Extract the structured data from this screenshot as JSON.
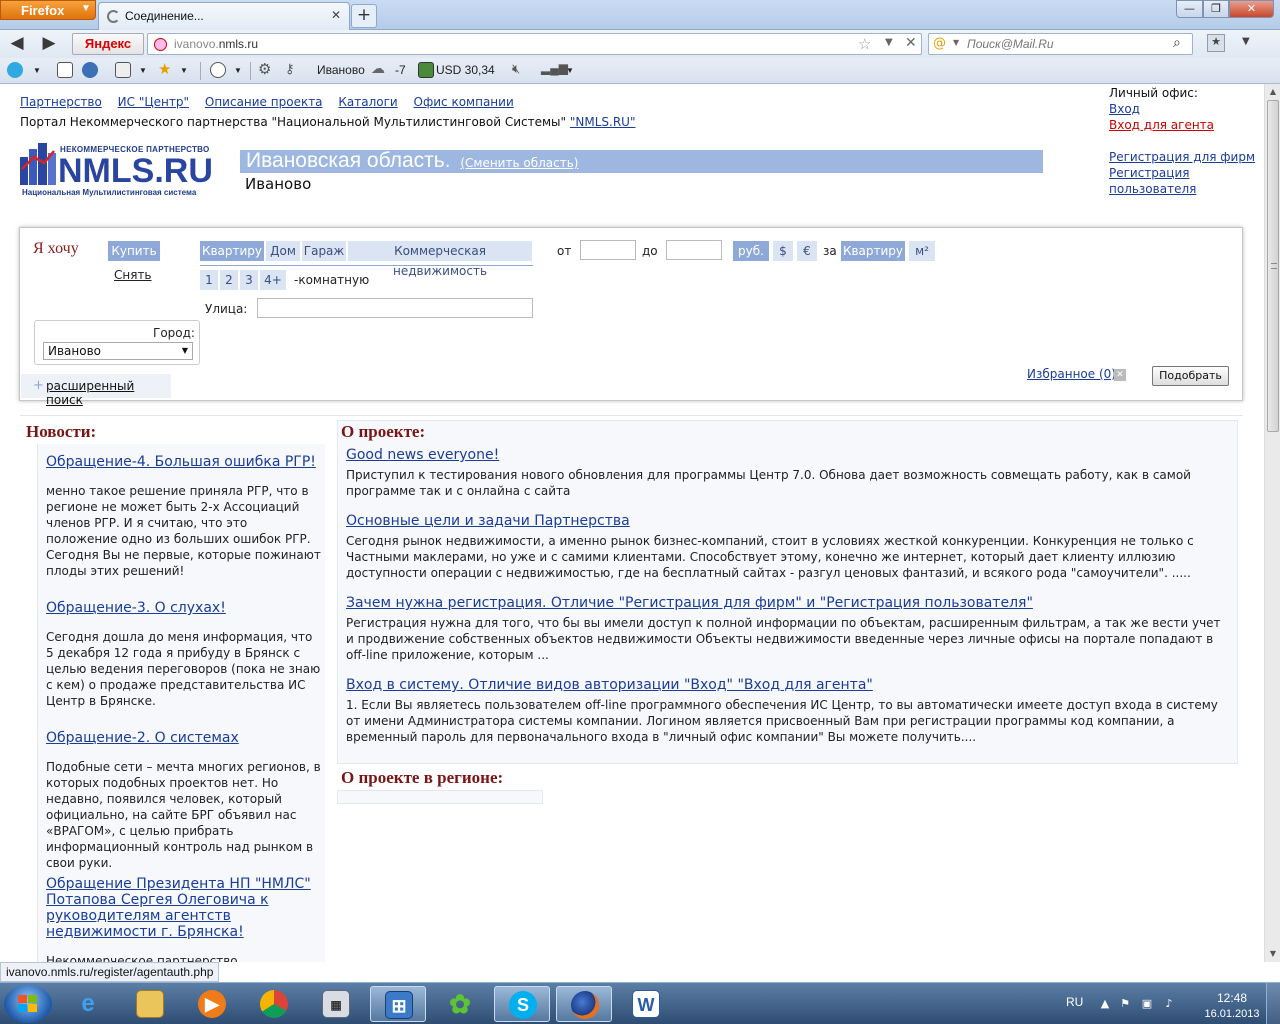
{
  "browser": {
    "app_button": "Firefox",
    "tab_title": "Соединение...",
    "yandex_button": "Яндекс",
    "url_host": "ivanovo.",
    "url_domain": "nmls.ru",
    "search_placeholder": "Поиск@Mail.Ru",
    "toolbar": {
      "city": "Иваново",
      "temperature": "-7",
      "currency": "USD 30,34"
    },
    "status_url": "ivanovo.nmls.ru/register/agentauth.php"
  },
  "header": {
    "links": [
      "Партнерство",
      "ИС \"Центр\"",
      "Описание проекта",
      "Каталоги",
      "Офис компании"
    ],
    "portal_text": "Портал Некоммерческого партнерства \"Национальной Мультилистинговой Системы\"",
    "portal_link": "\"NMLS.RU\"",
    "office_label": "Личный офис:",
    "login": "Вход",
    "agent_login": "Вход для агента",
    "register_firms": "Регистрация для фирм",
    "register_user": "Регистрация пользователя",
    "logo_top": "НЕКОММЕРЧЕСКОЕ ПАРТНЕРСТВО",
    "logo_brand": "NMLS.RU",
    "logo_sub": "Национальная Мультилистинговая система",
    "region": "Ивановская область.",
    "change_region": "(Сменить область)",
    "city": "Иваново"
  },
  "search": {
    "want_label": "Я хочу",
    "buy": "Купить",
    "rent": "Снять",
    "types": [
      "Квартиру",
      "Дом",
      "Гараж",
      "Коммерческая недвижимость"
    ],
    "rooms": [
      "1",
      "2",
      "3",
      "4+"
    ],
    "rooms_suffix": "-комнатную",
    "from_label": "от",
    "to_label": "до",
    "currencies": [
      "руб.",
      "$",
      "€"
    ],
    "per_label": "за",
    "per_options": [
      "Квартиру",
      "м²"
    ],
    "street_label": "Улица:",
    "city_label": "Город:",
    "city_value": "Иваново",
    "advanced": "расширенный поиск",
    "favorites": "Избранное (0)",
    "submit": "Подобрать"
  },
  "news": {
    "heading": "Новости:",
    "items": [
      {
        "title": "Обращение-4. Большая ошибка РГР!",
        "body": "менно такое решение приняла РГР, что в регионе не может быть 2-х Ассоциаций членов РГР. И я считаю, что это положение одно из больших ошибок РГР. Сегодня Вы не первые, которые пожинают плоды этих решений!"
      },
      {
        "title": "Обращение-3. О слухах!",
        "body": "Сегодня дошла до меня информация, что 5 декабря 12 года я прибуду в Брянск с целью ведения переговоров (пока не знаю с кем) о продаже представительства ИС Центр в Брянске."
      },
      {
        "title": "Обращение-2. О системах",
        "body": "Подобные сети – мечта многих регионов, в которых подобных проектов нет. Но недавно, появился человек, который официально, на сайте БРГ объявил нас «ВРАГОМ», с целью прибрать информационный контроль над рынком в свои руки."
      },
      {
        "title": "Обращение Президента НП \"НМЛС\" Потапова Сергея Олеговича к руководителям агентств недвижимости г. Брянска!",
        "body": "Некоммерческое партнерство «Национальная Мультилистинговая Система» создано с целью"
      }
    ]
  },
  "about": {
    "heading": "О проекте:",
    "items": [
      {
        "title": "Good news everyone!",
        "body": "Приступил к тестирования нового обновления для программы Центр 7.0. Обнова дает возможность совмещать работу, как в самой программе так и с онлайна с сайта"
      },
      {
        "title": "Основные цели и задачи Партнерства",
        "body": "Сегодня рынок недвижимости, а именно рынок бизнес-компаний, стоит в условиях жесткой конкуренции. Конкуренция не только с Частными маклерами, но уже и с самими клиентами. Способствует этому, конечно же интернет, который дает клиенту иллюзию доступности операции с недвижимостью, где на бесплатный сайтах - разгул ценовых фантазий, и всякого рода \"самоучители\". ....."
      },
      {
        "title": "Зачем нужна регистрация. Отличие \"Регистрация для фирм\" и \"Регистрация пользователя\"",
        "body": "Регистрация нужна для того, что бы вы имели доступ к полной информации по объектам, расширенным фильтрам, а так же вести учет и продвижение собственных объектов недвижимости Объекты недвижимости введенные через личные офисы на портале попадают в off-line приложение, которым ..."
      },
      {
        "title": "Вход в систему. Отличие видов авторизации \"Вход\" \"Вход для агента\"",
        "body": "1. Если Вы являетесь пользователем off-line программного обеспечения ИС Центр, то вы автоматически имеете доступ входа в систему от имени Администратора системы компании. Логином является присвоенный Вам при регистрации программы код компании, а временный пароль для первоначального входа в \"личный офис компании\" Вы можете получить...."
      }
    ],
    "region_heading": "О проекте в регионе:"
  },
  "taskbar": {
    "lang": "RU",
    "time": "12:48",
    "date": "16.01.2013"
  },
  "colors": {
    "accent_blue": "#8ea9d8",
    "link": "#1a3d9a",
    "heading_red": "#7a1515",
    "brand": "#2a45a0"
  }
}
